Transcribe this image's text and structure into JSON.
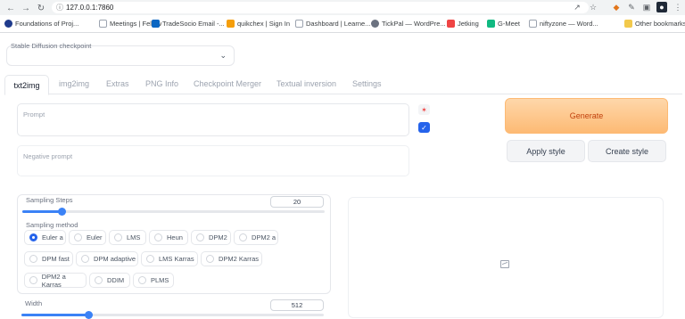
{
  "browser": {
    "url": "127.0.0.1:7860",
    "bookmarks": [
      {
        "label": "Foundations of Proj...",
        "icon": "globe-icon",
        "color": "#5f6368"
      },
      {
        "label": "Meetings | Fellow",
        "icon": "fellow-icon",
        "color": "#6b7280"
      },
      {
        "label": "TradeSocio Email -...",
        "icon": "outlook-icon",
        "color": "#0a66c2"
      },
      {
        "label": "quikchex | Sign In",
        "icon": "quikchex-icon",
        "color": "#f59e0b"
      },
      {
        "label": "Dashboard | Learne...",
        "icon": "page-icon",
        "color": "#9ca3af"
      },
      {
        "label": "TickPal — WordPre...",
        "icon": "wordpress-icon",
        "color": "#6b7280"
      },
      {
        "label": "Jetking",
        "icon": "jetking-icon",
        "color": "#ef4444"
      },
      {
        "label": "G-Meet",
        "icon": "meet-icon",
        "color": "#10b981"
      },
      {
        "label": "niftyzone — Word...",
        "icon": "page-icon",
        "color": "#9ca3af"
      },
      {
        "label": "Other bookmarks",
        "icon": "folder-icon",
        "color": "#f2c94c"
      }
    ]
  },
  "checkpoint": {
    "label": "Stable Diffusion checkpoint",
    "value": ""
  },
  "tabs": [
    "txt2img",
    "img2img",
    "Extras",
    "PNG Info",
    "Checkpoint Merger",
    "Textual inversion",
    "Settings"
  ],
  "prompt": {
    "placeholder": "Prompt",
    "negative_placeholder": "Negative prompt"
  },
  "buttons": {
    "generate": "Generate",
    "apply_style": "Apply style",
    "create_style": "Create style"
  },
  "sampling": {
    "steps_label": "Sampling Steps",
    "steps_value": "20",
    "steps_fraction": 0.13,
    "method_label": "Sampling method",
    "methods": [
      "Euler a",
      "Euler",
      "LMS",
      "Heun",
      "DPM2",
      "DPM2 a",
      "DPM fast",
      "DPM adaptive",
      "LMS Karras",
      "DPM2 Karras",
      "DPM2 a Karras",
      "DDIM",
      "PLMS"
    ],
    "selected": "Euler a"
  },
  "size": {
    "width_label": "Width",
    "width_value": "512",
    "width_fraction": 0.22
  },
  "colors": {
    "accent": "#3b82f6",
    "generate_bg": "#fdba74",
    "generate_text": "#c2410c"
  }
}
